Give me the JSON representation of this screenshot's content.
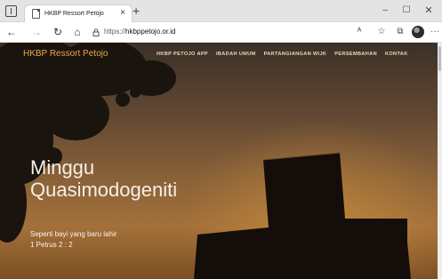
{
  "browser": {
    "tab_title": "HKBP Ressort Petojo",
    "tab_close": "×",
    "new_tab": "+",
    "window_minimize": "–",
    "window_maximize": "☐",
    "window_close": "✕",
    "nav_back": "←",
    "nav_forward": "→",
    "nav_reload": "↻",
    "nav_home": "⌂",
    "url_prefix": "https://",
    "url_domain": "hkbppetojo.or.id",
    "toolbar_read": "ᴬ",
    "toolbar_favorite": "☆",
    "toolbar_collections": "⧉",
    "toolbar_more": "···"
  },
  "site": {
    "logo": "HKBP Ressort Petojo",
    "nav": [
      {
        "label": "HKBP PETOJO APP"
      },
      {
        "label": "IBADAH UMUM"
      },
      {
        "label": "PARTANGIANGAN WIJK"
      },
      {
        "label": "PERSEMBAHAN"
      },
      {
        "label": "KONTAK"
      }
    ]
  },
  "hero": {
    "title": "Minggu Quasimodogeniti",
    "quote": "Seperti bayi yang baru lahir",
    "reference": "1 Petrus 2 : 2"
  },
  "colors": {
    "logo": "#e9a74a",
    "sky_top": "#3b3028",
    "sky_glow": "#a4703a"
  }
}
